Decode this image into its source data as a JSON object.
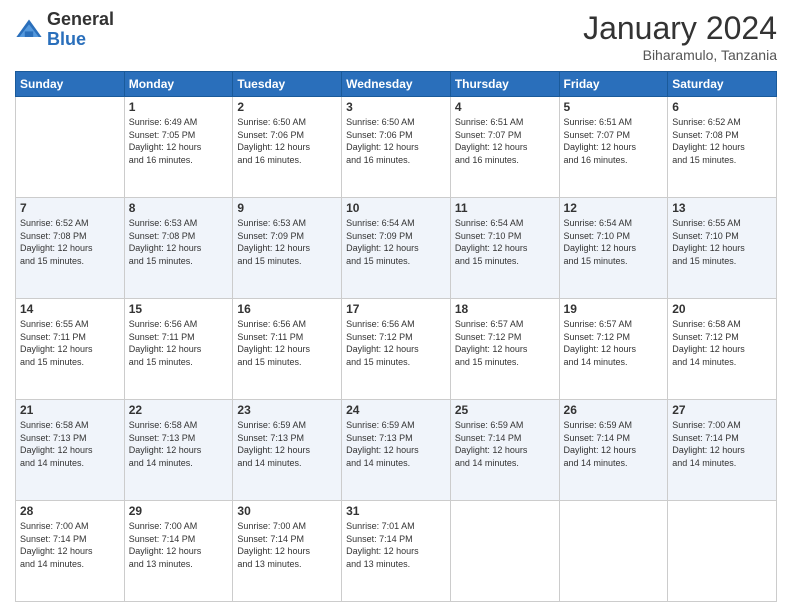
{
  "header": {
    "logo_general": "General",
    "logo_blue": "Blue",
    "month_title": "January 2024",
    "location": "Biharamulo, Tanzania"
  },
  "weekdays": [
    "Sunday",
    "Monday",
    "Tuesday",
    "Wednesday",
    "Thursday",
    "Friday",
    "Saturday"
  ],
  "weeks": [
    [
      {
        "day": "",
        "info": ""
      },
      {
        "day": "1",
        "info": "Sunrise: 6:49 AM\nSunset: 7:05 PM\nDaylight: 12 hours\nand 16 minutes."
      },
      {
        "day": "2",
        "info": "Sunrise: 6:50 AM\nSunset: 7:06 PM\nDaylight: 12 hours\nand 16 minutes."
      },
      {
        "day": "3",
        "info": "Sunrise: 6:50 AM\nSunset: 7:06 PM\nDaylight: 12 hours\nand 16 minutes."
      },
      {
        "day": "4",
        "info": "Sunrise: 6:51 AM\nSunset: 7:07 PM\nDaylight: 12 hours\nand 16 minutes."
      },
      {
        "day": "5",
        "info": "Sunrise: 6:51 AM\nSunset: 7:07 PM\nDaylight: 12 hours\nand 16 minutes."
      },
      {
        "day": "6",
        "info": "Sunrise: 6:52 AM\nSunset: 7:08 PM\nDaylight: 12 hours\nand 15 minutes."
      }
    ],
    [
      {
        "day": "7",
        "info": "Sunrise: 6:52 AM\nSunset: 7:08 PM\nDaylight: 12 hours\nand 15 minutes."
      },
      {
        "day": "8",
        "info": "Sunrise: 6:53 AM\nSunset: 7:08 PM\nDaylight: 12 hours\nand 15 minutes."
      },
      {
        "day": "9",
        "info": "Sunrise: 6:53 AM\nSunset: 7:09 PM\nDaylight: 12 hours\nand 15 minutes."
      },
      {
        "day": "10",
        "info": "Sunrise: 6:54 AM\nSunset: 7:09 PM\nDaylight: 12 hours\nand 15 minutes."
      },
      {
        "day": "11",
        "info": "Sunrise: 6:54 AM\nSunset: 7:10 PM\nDaylight: 12 hours\nand 15 minutes."
      },
      {
        "day": "12",
        "info": "Sunrise: 6:54 AM\nSunset: 7:10 PM\nDaylight: 12 hours\nand 15 minutes."
      },
      {
        "day": "13",
        "info": "Sunrise: 6:55 AM\nSunset: 7:10 PM\nDaylight: 12 hours\nand 15 minutes."
      }
    ],
    [
      {
        "day": "14",
        "info": "Sunrise: 6:55 AM\nSunset: 7:11 PM\nDaylight: 12 hours\nand 15 minutes."
      },
      {
        "day": "15",
        "info": "Sunrise: 6:56 AM\nSunset: 7:11 PM\nDaylight: 12 hours\nand 15 minutes."
      },
      {
        "day": "16",
        "info": "Sunrise: 6:56 AM\nSunset: 7:11 PM\nDaylight: 12 hours\nand 15 minutes."
      },
      {
        "day": "17",
        "info": "Sunrise: 6:56 AM\nSunset: 7:12 PM\nDaylight: 12 hours\nand 15 minutes."
      },
      {
        "day": "18",
        "info": "Sunrise: 6:57 AM\nSunset: 7:12 PM\nDaylight: 12 hours\nand 15 minutes."
      },
      {
        "day": "19",
        "info": "Sunrise: 6:57 AM\nSunset: 7:12 PM\nDaylight: 12 hours\nand 14 minutes."
      },
      {
        "day": "20",
        "info": "Sunrise: 6:58 AM\nSunset: 7:12 PM\nDaylight: 12 hours\nand 14 minutes."
      }
    ],
    [
      {
        "day": "21",
        "info": "Sunrise: 6:58 AM\nSunset: 7:13 PM\nDaylight: 12 hours\nand 14 minutes."
      },
      {
        "day": "22",
        "info": "Sunrise: 6:58 AM\nSunset: 7:13 PM\nDaylight: 12 hours\nand 14 minutes."
      },
      {
        "day": "23",
        "info": "Sunrise: 6:59 AM\nSunset: 7:13 PM\nDaylight: 12 hours\nand 14 minutes."
      },
      {
        "day": "24",
        "info": "Sunrise: 6:59 AM\nSunset: 7:13 PM\nDaylight: 12 hours\nand 14 minutes."
      },
      {
        "day": "25",
        "info": "Sunrise: 6:59 AM\nSunset: 7:14 PM\nDaylight: 12 hours\nand 14 minutes."
      },
      {
        "day": "26",
        "info": "Sunrise: 6:59 AM\nSunset: 7:14 PM\nDaylight: 12 hours\nand 14 minutes."
      },
      {
        "day": "27",
        "info": "Sunrise: 7:00 AM\nSunset: 7:14 PM\nDaylight: 12 hours\nand 14 minutes."
      }
    ],
    [
      {
        "day": "28",
        "info": "Sunrise: 7:00 AM\nSunset: 7:14 PM\nDaylight: 12 hours\nand 14 minutes."
      },
      {
        "day": "29",
        "info": "Sunrise: 7:00 AM\nSunset: 7:14 PM\nDaylight: 12 hours\nand 13 minutes."
      },
      {
        "day": "30",
        "info": "Sunrise: 7:00 AM\nSunset: 7:14 PM\nDaylight: 12 hours\nand 13 minutes."
      },
      {
        "day": "31",
        "info": "Sunrise: 7:01 AM\nSunset: 7:14 PM\nDaylight: 12 hours\nand 13 minutes."
      },
      {
        "day": "",
        "info": ""
      },
      {
        "day": "",
        "info": ""
      },
      {
        "day": "",
        "info": ""
      }
    ]
  ]
}
